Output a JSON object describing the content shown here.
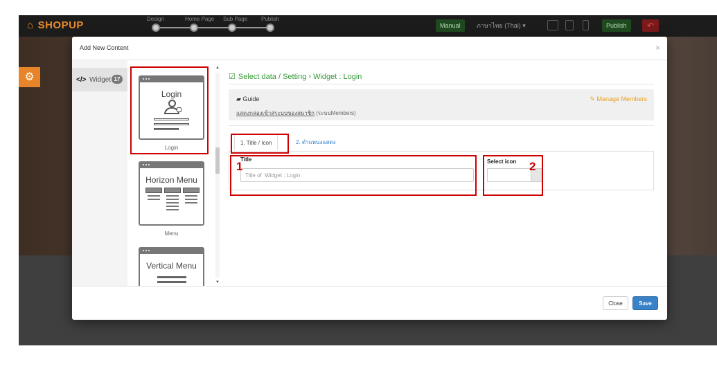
{
  "app": {
    "logo_text": "SHOPUP"
  },
  "builder_steps": [
    "Design",
    "Home Page",
    "Sub Page",
    "Publish"
  ],
  "topbar": {
    "manual_label": "Manual",
    "language_label": "ภาษาไทย (Thai) ▾",
    "publish_label": "Publish",
    "undo_icon": "undo-icon"
  },
  "modal": {
    "title": "Add New Content",
    "close_glyph": "×",
    "sidebar": {
      "code_glyph": "</>",
      "widget_label": "Widget",
      "widget_count": "17"
    },
    "widgets": [
      {
        "name": "Login",
        "caption": "Login"
      },
      {
        "name": "Horizon Menu",
        "caption": "Menu"
      },
      {
        "name": "Vertical Menu",
        "caption": ""
      }
    ],
    "breadcrumb": "Select data / Setting › Widget : Login",
    "guide": {
      "title": "Guide",
      "description_link": "แสดงกล่องเข้าสู่ระบบของสมาชิก",
      "description_suffix": "(ระบบMembers)",
      "manage_link": "Manage Members"
    },
    "tabs": [
      {
        "label": "1. Title / Icon",
        "active": true
      },
      {
        "label": "2. ตำแหน่งแสดง",
        "active": false
      }
    ],
    "form": {
      "title_label": "Title",
      "title_placeholder": "Title of  Widget : Login",
      "title_value": "",
      "icon_label": "Select icon",
      "icon_value": ""
    },
    "footer": {
      "close_label": "Close",
      "save_label": "Save"
    }
  },
  "annotations": [
    "1",
    "2"
  ],
  "colors": {
    "accent_green": "#3a9a3a",
    "annotation_red": "#cc0000",
    "save_blue": "#3a82c8",
    "manage_orange": "#e8a020",
    "logo_orange": "#e88a2a"
  }
}
